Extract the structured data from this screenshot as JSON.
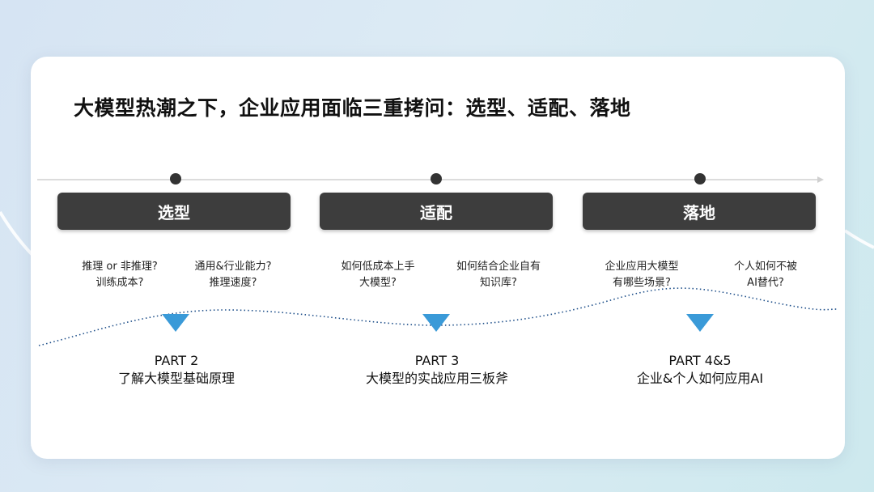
{
  "title": "大模型热潮之下，企业应用面临三重拷问：选型、适配、落地",
  "stages": [
    {
      "label": "选型",
      "questions": [
        {
          "line1": "推理 or 非推理?",
          "line2": "训练成本?"
        },
        {
          "line1": "通用&行业能力?",
          "line2": "推理速度?"
        }
      ],
      "part": "PART 2",
      "part_desc": "了解大模型基础原理"
    },
    {
      "label": "适配",
      "questions": [
        {
          "line1": "如何低成本上手",
          "line2": "大模型?"
        },
        {
          "line1": "如何结合企业自有",
          "line2": "知识库?"
        }
      ],
      "part": "PART 3",
      "part_desc": "大模型的实战应用三板斧"
    },
    {
      "label": "落地",
      "questions": [
        {
          "line1": "企业应用大模型",
          "line2": "有哪些场景?"
        },
        {
          "line1": "个人如何不被",
          "line2": "AI替代?"
        }
      ],
      "part": "PART 4&5",
      "part_desc": "企业&个人如何应用AI"
    }
  ],
  "colors": {
    "pill": "#3d3d3d",
    "marker": "#3a9ad8",
    "dot": "#333333",
    "timeline": "#d0d0d0"
  }
}
